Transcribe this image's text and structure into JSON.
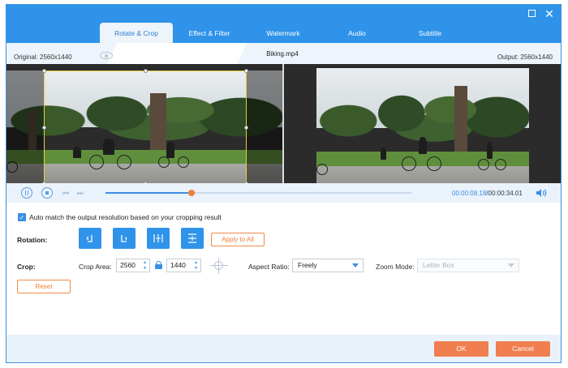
{
  "window": {
    "maximize_icon": "maximize-icon",
    "close_icon": "close-icon",
    "close_glyph": "✕"
  },
  "tabs": [
    {
      "label": "Rotate & Crop",
      "active": true
    },
    {
      "label": "Effect & Filter",
      "active": false
    },
    {
      "label": "Watermark",
      "active": false
    },
    {
      "label": "Audio",
      "active": false
    },
    {
      "label": "Subtitle",
      "active": false
    }
  ],
  "info": {
    "original": "Original: 2560x1440",
    "filename": "Biking.mp4",
    "output": "Output: 2560x1440"
  },
  "player": {
    "current_time": "00:00:08.18",
    "separator": "/",
    "total_time": "00:00:34.01",
    "progress": 0.28
  },
  "settings": {
    "auto_match_checked": true,
    "auto_match_label": "Auto match the output resolution based on your cropping result",
    "rotation_label": "Rotation:",
    "apply_to_all": "Apply to All",
    "crop_label": "Crop:",
    "crop_area_label": "Crop Area:",
    "crop_width": "2560",
    "crop_height": "1440",
    "aspect_ratio_label": "Aspect Ratio:",
    "aspect_ratio_value": "Freely",
    "zoom_mode_label": "Zoom Mode:",
    "zoom_mode_value": "Letter Box",
    "reset": "Reset"
  },
  "footer": {
    "ok": "OK",
    "cancel": "Cancel"
  },
  "colors": {
    "accent": "#2f93ea",
    "orange": "#f07e35",
    "crop_frame": "#e8d23c"
  }
}
